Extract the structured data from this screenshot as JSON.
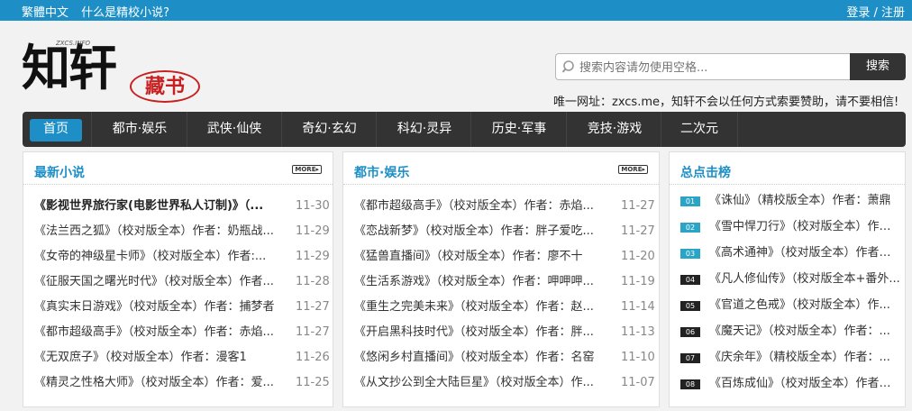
{
  "topbar": {
    "left": [
      "繁體中文",
      "什么是精校小说?"
    ],
    "right": "登录 / 注册"
  },
  "logo": {
    "main": "知轩",
    "seal": "藏书",
    "subtext": "ZXCS.INFO"
  },
  "search": {
    "placeholder": "搜索内容请勿使用空格...",
    "button": "搜索"
  },
  "notice": "唯一网址：zxcs.me，知轩不会以任何方式索要赞助，请不要相信!",
  "nav": [
    "首页",
    "都市·娱乐",
    "武侠·仙侠",
    "奇幻·玄幻",
    "科幻·灵异",
    "历史·军事",
    "竞技·游戏",
    "二次元"
  ],
  "latest": {
    "title": "最新小说",
    "more": "MORE▸",
    "items": [
      {
        "title": "《影视世界旅行家(电影世界私人订制)》（...",
        "date": "11-30"
      },
      {
        "title": "《法兰西之狐》（校对版全本）作者：奶瓶战...",
        "date": "11-29"
      },
      {
        "title": "《女帝的神级星卡师》（校对版全本）作者:...",
        "date": "11-29"
      },
      {
        "title": "《征服天国之曙光时代》（校对版全本）作者...",
        "date": "11-28"
      },
      {
        "title": "《真实末日游戏》（校对版全本）作者：捕梦者",
        "date": "11-27"
      },
      {
        "title": "《都市超级高手》（校对版全本）作者：赤焰...",
        "date": "11-27"
      },
      {
        "title": "《无双庶子》（校对版全本）作者：漫客1",
        "date": "11-26"
      },
      {
        "title": "《精灵之性格大师》（校对版全本）作者：爱...",
        "date": "11-25"
      }
    ]
  },
  "urban": {
    "title": "都市·娱乐",
    "more": "MORE▸",
    "items": [
      {
        "title": "《都市超级高手》（校对版全本）作者：赤焰...",
        "date": "11-27"
      },
      {
        "title": "《恋战新梦》（校对版全本）作者：胖子爱吃...",
        "date": "11-27"
      },
      {
        "title": "《猛兽直播间》（校对版全本）作者：廖不十",
        "date": "11-20"
      },
      {
        "title": "《生活系游戏》（校对版全本）作者：呷呷呷...",
        "date": "11-19"
      },
      {
        "title": "《重生之完美未来》（校对版全本）作者：赵...",
        "date": "11-14"
      },
      {
        "title": "《开启黑科技时代》（校对版全本）作者：胖...",
        "date": "11-13"
      },
      {
        "title": "《悠闲乡村直播间》（校对版全本）作者：名窑",
        "date": "11-10"
      },
      {
        "title": "《从文抄公到全大陆巨星》（校对版全本）作...",
        "date": "11-07"
      }
    ]
  },
  "hot": {
    "title": "总点击榜",
    "items": [
      {
        "rank": "01",
        "title": "《诛仙》（精校版全本）作者：萧鼎",
        "color": "#2aa5c6"
      },
      {
        "rank": "02",
        "title": "《雪中悍刀行》（校对版全本）作者：烽...",
        "color": "#2aa5c6"
      },
      {
        "rank": "03",
        "title": "《高术通神》（校对版全本）作者：...",
        "color": "#2aa5c6"
      },
      {
        "rank": "04",
        "title": "《凡人修仙传》（校对版全本+番外...",
        "color": "#222222"
      },
      {
        "rank": "05",
        "title": "《官道之色戒》（校对版全本）作...",
        "color": "#222222"
      },
      {
        "rank": "06",
        "title": "《魔天记》（校对版全本）作者：...",
        "color": "#222222"
      },
      {
        "rank": "07",
        "title": "《庆余年》（精校版全本）作者：...",
        "color": "#222222"
      },
      {
        "rank": "08",
        "title": "《百炼成仙》（校对版全本）作者：...",
        "color": "#222222"
      }
    ]
  }
}
